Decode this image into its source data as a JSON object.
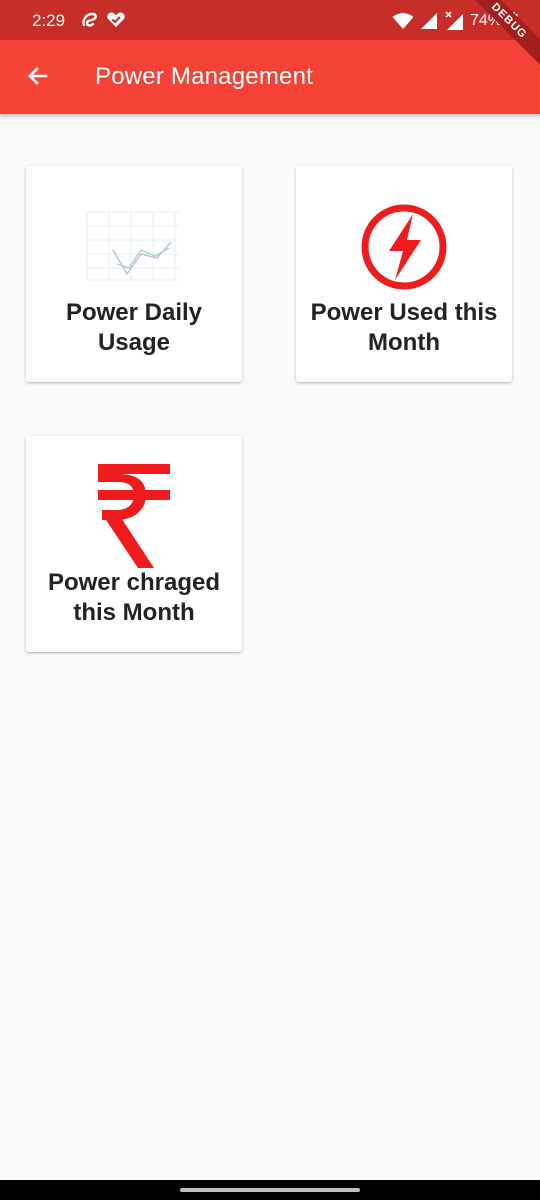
{
  "status_bar": {
    "time": "2:29",
    "battery": "74%",
    "icons": [
      "airtel-icon",
      "heart-check-icon",
      "wifi-icon",
      "signal-icon",
      "signal-x-icon",
      "battery-icon"
    ]
  },
  "app_bar": {
    "title": "Power Management",
    "back_icon": "arrow-back-icon",
    "color": "#f44336"
  },
  "debug_banner": "DEBUG",
  "cards": [
    {
      "label_line1": "Power Daily",
      "label_line2": "Usage",
      "icon": "line-chart-icon"
    },
    {
      "label_line1": "Power Used this",
      "label_line2": "Month",
      "icon": "lightning-icon"
    },
    {
      "label_line1": "Power chraged",
      "label_line2": "this Month",
      "icon": "rupee-icon"
    }
  ],
  "colors": {
    "status_bar": "#c62e27",
    "accent": "#ee1c1c",
    "background": "#fafafa"
  }
}
